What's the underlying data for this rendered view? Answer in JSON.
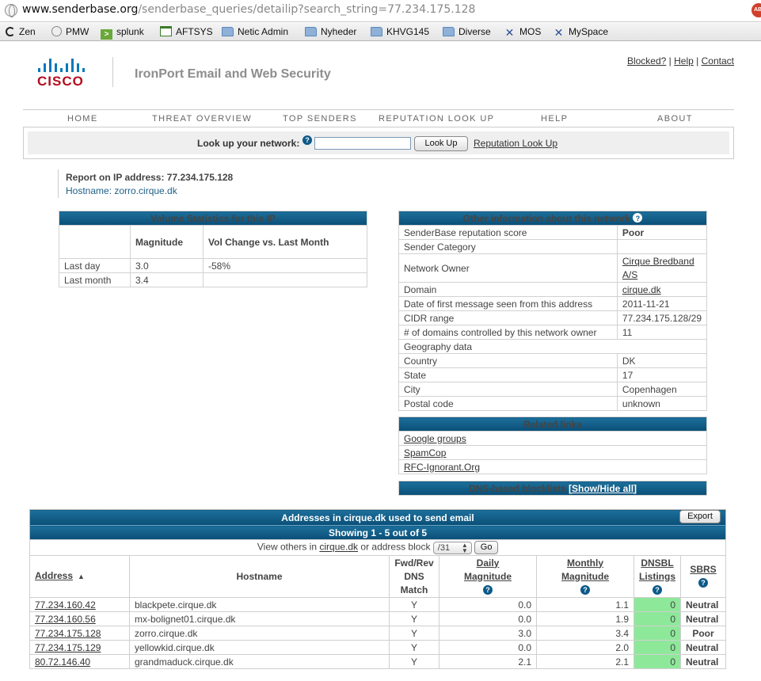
{
  "browser": {
    "url_host": "www.senderbase.org",
    "url_path": "/senderbase_queries/detailip?search_string=77.234.175.128",
    "bookmarks": [
      "Zen",
      "PMW",
      "splunk",
      "AFTSYS",
      "Netic Admin",
      "Nyheder",
      "KHVG145",
      "Diverse",
      "MOS",
      "MySpace"
    ]
  },
  "header": {
    "logo_text": "CISCO",
    "product_title": "IronPort Email and Web Security",
    "links": [
      "Blocked?",
      "Help",
      "Contact"
    ],
    "separator": "|"
  },
  "nav": [
    "HOME",
    "THREAT OVERVIEW",
    "TOP SENDERS",
    "REPUTATION LOOK UP",
    "HELP",
    "ABOUT"
  ],
  "lookup": {
    "label": "Look up your network:",
    "button": "Look Up",
    "link": "Reputation Look Up",
    "value": ""
  },
  "report": {
    "title": "Report on IP address: 77.234.175.128",
    "hostname": "Hostname: zorro.cirque.dk"
  },
  "volume": {
    "title": "Volume Statistics for this IP",
    "col_magnitude": "Magnitude",
    "col_change": "Vol Change  vs. Last Month",
    "rows": [
      {
        "label": "Last day",
        "magnitude": "3.0",
        "change": "-58%"
      },
      {
        "label": "Last month",
        "magnitude": "3.4",
        "change": ""
      }
    ]
  },
  "other": {
    "title": "Other information about this network",
    "reputation_label": "SenderBase reputation score",
    "reputation_value": "Poor",
    "category_label": "Sender Category",
    "category_value": "",
    "owner_label": "Network Owner",
    "owner_value": "Cirque Bredband A/S",
    "domain_label": "Domain",
    "domain_value": "cirque.dk",
    "first_msg_label": "Date of first message seen from this address",
    "first_msg_value": "2011-11-21",
    "cidr_label": "CIDR range",
    "cidr_value": "77.234.175.128/29",
    "domains_label": "# of domains controlled by this network owner",
    "domains_value": "11",
    "geo_label": "Geography data",
    "country_label": "Country",
    "country_value": "DK",
    "state_label": "State",
    "state_value": "17",
    "city_label": "City",
    "city_value": "Copenhagen",
    "postal_label": "Postal code",
    "postal_value": "unknown"
  },
  "related": {
    "title": "Related links",
    "links": [
      "Google groups",
      "SpamCop",
      "RFC-Ignorant.Org"
    ]
  },
  "dns": {
    "title": "DNS-based blocklists",
    "toggle": "[Show/Hide all]"
  },
  "addresses": {
    "title": "Addresses in cirque.dk used to send email",
    "export": "Export",
    "showing": "Showing 1 - 5 out of 5",
    "view_prefix": "View others in",
    "view_domain": "cirque.dk",
    "view_middle": "or address block",
    "block_value": "/31",
    "go": "Go",
    "columns": {
      "address": "Address",
      "hostname": "Hostname",
      "fwd1": "Fwd/Rev",
      "fwd2": "DNS",
      "fwd3": "Match",
      "daily1": "Daily",
      "daily2": "Magnitude",
      "monthly1": "Monthly",
      "monthly2": "Magnitude",
      "dnsbl1": "DNSBL",
      "dnsbl2": "Listings",
      "sbrs": "SBRS"
    },
    "rows": [
      {
        "address": "77.234.160.42",
        "hostname": "blackpete.cirque.dk",
        "match": "Y",
        "daily": "0.0",
        "monthly": "1.1",
        "dnsbl": "0",
        "sbrs": "Neutral"
      },
      {
        "address": "77.234.160.56",
        "hostname": "mx-bolignet01.cirque.dk",
        "match": "Y",
        "daily": "0.0",
        "monthly": "1.9",
        "dnsbl": "0",
        "sbrs": "Neutral"
      },
      {
        "address": "77.234.175.128",
        "hostname": "zorro.cirque.dk",
        "match": "Y",
        "daily": "3.0",
        "monthly": "3.4",
        "dnsbl": "0",
        "sbrs": "Poor"
      },
      {
        "address": "77.234.175.129",
        "hostname": "yellowkid.cirque.dk",
        "match": "Y",
        "daily": "0.0",
        "monthly": "2.0",
        "dnsbl": "0",
        "sbrs": "Neutral"
      },
      {
        "address": "80.72.146.40",
        "hostname": "grandmaduck.cirque.dk",
        "match": "Y",
        "daily": "2.1",
        "monthly": "2.1",
        "dnsbl": "0",
        "sbrs": "Neutral"
      }
    ]
  },
  "colors": {
    "header_blue": "#0a4f77",
    "poor_red": "#c00000",
    "dnsbl_green": "#8ee89a",
    "cisco_red": "#b40d1e",
    "cisco_blue": "#0a78ba"
  },
  "icons": {
    "help": "?"
  }
}
